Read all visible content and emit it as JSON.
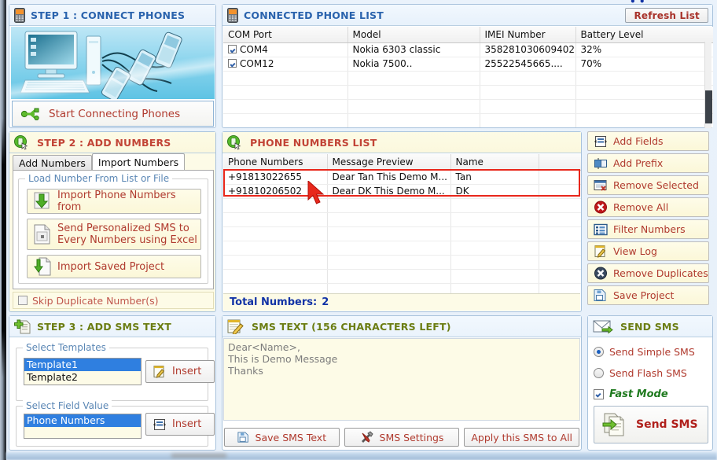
{
  "step1": {
    "icon": "mobile-phone-icon",
    "title": "STEP 1 : CONNECT PHONES",
    "connect_button": {
      "label": "Start Connecting Phones",
      "icon": "usb-icon"
    },
    "hero_alt": "computer connected to mobile phones illustration"
  },
  "connected_phone_list": {
    "icon": "mobile-phone-icon",
    "title": "CONNECTED PHONE LIST",
    "refresh_button": "Refresh List",
    "columns": [
      "COM  Port",
      "Model",
      "IMEI Number",
      "Battery Level"
    ],
    "rows": [
      {
        "checked": true,
        "port": "COM4",
        "model": "Nokia 6303 classic",
        "imei": "358281030609402",
        "battery": "32%"
      },
      {
        "checked": true,
        "port": "COM12",
        "model": "Nokia 7500..",
        "imei": "25522545665....",
        "battery": "70%"
      }
    ]
  },
  "step2": {
    "icon": "mobile-phone-cursor-icon",
    "title": "STEP 2 : ADD NUMBERS",
    "tabs": [
      {
        "label": "Add Numbers",
        "active": false
      },
      {
        "label": "Import Numbers",
        "active": true
      }
    ],
    "group_legend": "Load Number From List or File",
    "buttons": [
      {
        "label": "Import Phone Numbers from",
        "icon": "download-arrow-icon"
      },
      {
        "label": "Send Personalized SMS to\nEvery Numbers using Excel",
        "icon": "excel-file-icon"
      },
      {
        "label": "Import Saved Project",
        "icon": "import-file-icon"
      }
    ],
    "skip_duplicate": {
      "label": "Skip Duplicate Number(s)",
      "checked": false
    }
  },
  "phone_numbers_list": {
    "icon": "mobile-phone-cursor-icon",
    "title": "PHONE NUMBERS LIST",
    "columns": [
      "Phone Numbers",
      "Message Preview",
      "Name",
      ""
    ],
    "rows": [
      {
        "number": "+91813022655",
        "preview": "Dear Tan This Demo M...",
        "name": "Tan"
      },
      {
        "number": "+91810206502",
        "preview": "Dear DK This Demo M...",
        "name": "DK"
      }
    ],
    "total_label": "Total Numbers:",
    "total_value": "2",
    "selection_highlight_color": "#e8271b"
  },
  "actions": [
    {
      "label": "Add Fields",
      "icon": "add-fields-icon"
    },
    {
      "label": "Add Prefix",
      "icon": "add-prefix-icon"
    },
    {
      "label": "Remove Selected",
      "icon": "remove-selected-icon"
    },
    {
      "label": "Remove All",
      "icon": "remove-all-icon"
    },
    {
      "label": "Filter Numbers",
      "icon": "filter-icon"
    },
    {
      "label": "View Log",
      "icon": "view-log-icon"
    },
    {
      "label": "Remove Duplicates",
      "icon": "remove-duplicates-icon"
    },
    {
      "label": "Save Project",
      "icon": "save-project-icon"
    }
  ],
  "step3": {
    "icon": "add-document-icon",
    "title": "STEP 3 : ADD SMS TEXT",
    "templates_legend": "Select Templates",
    "templates": [
      {
        "label": "Template1",
        "selected": true
      },
      {
        "label": "Template2",
        "selected": false
      }
    ],
    "templates_insert": {
      "label": "Insert",
      "icon": "edit-note-icon"
    },
    "field_legend": "Select Field Value",
    "fields": [
      {
        "label": "Phone Numbers",
        "selected": true
      }
    ],
    "field_insert": {
      "label": "Insert",
      "icon": "add-fields-icon"
    }
  },
  "sms_text": {
    "icon": "notepad-pencil-icon",
    "title": "SMS TEXT (156 CHARACTERS LEFT)",
    "body": "Dear<Name>,\nThis is Demo Message\nThanks",
    "buttons": [
      {
        "label": "Save SMS Text",
        "icon": "save-icon"
      },
      {
        "label": "SMS Settings",
        "icon": "tools-icon"
      },
      {
        "label": "Apply this SMS to All",
        "icon": "none"
      }
    ]
  },
  "send_sms": {
    "icon": "envelope-arrow-icon",
    "title": "SEND SMS",
    "options": [
      {
        "label": "Send Simple SMS",
        "selected": true
      },
      {
        "label": "Send Flash SMS",
        "selected": false
      }
    ],
    "fast_mode": {
      "label": "Fast Mode",
      "checked": true
    },
    "send_button": {
      "label": "Send SMS",
      "icon": "send-document-icon"
    }
  },
  "colors": {
    "header_blue": "#2a63ad",
    "header_red": "#c24436",
    "button_text": "#b03a2e",
    "total_blue": "#1233a6",
    "fast_mode_green": "#1f7a1f",
    "selection_red": "#e8271b",
    "panel_yellow": "#fdfbe7"
  }
}
